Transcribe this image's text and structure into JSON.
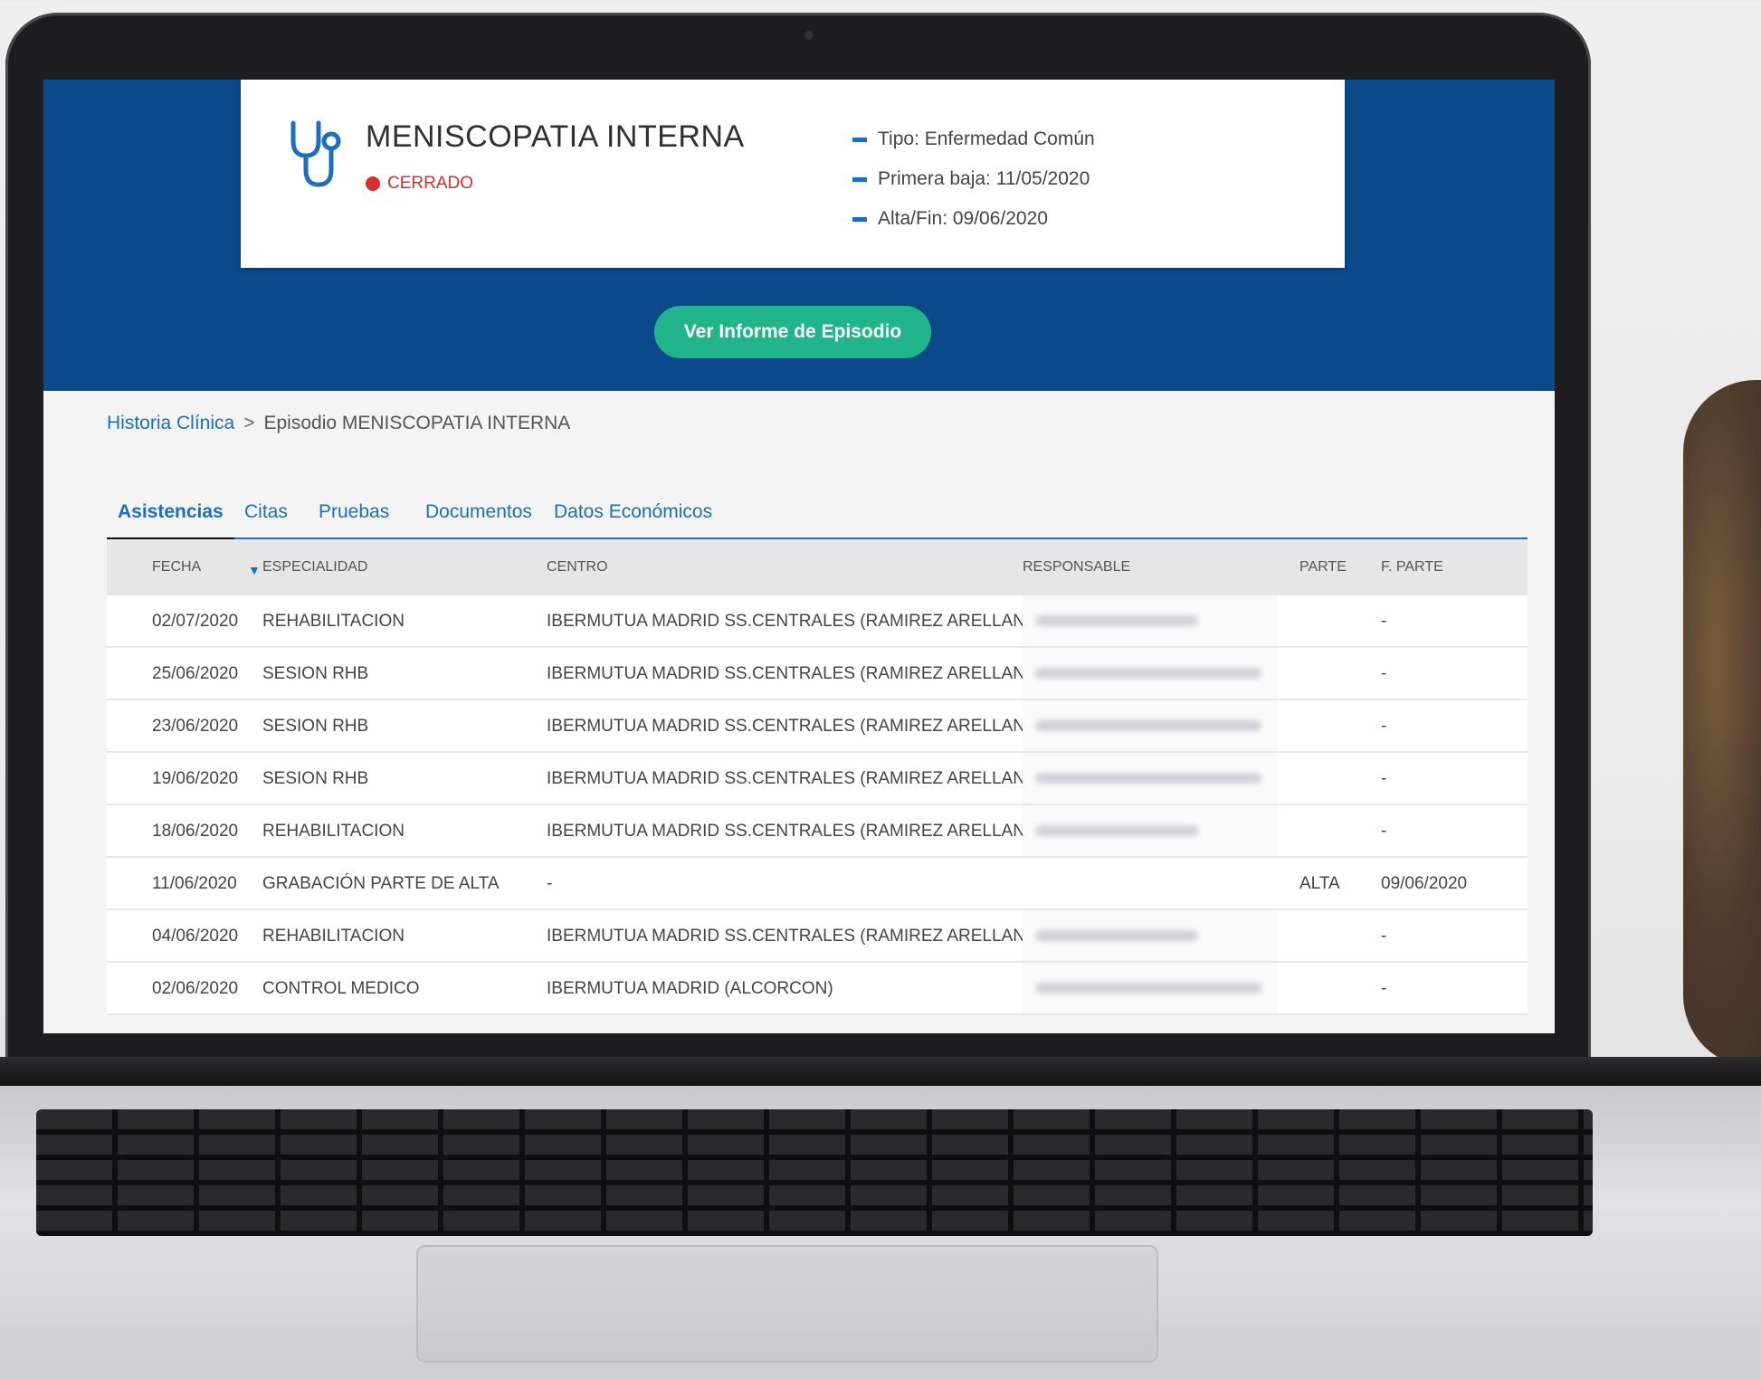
{
  "episode": {
    "title": "MENISCOPATIA INTERNA",
    "status": "CERRADO",
    "status_color": "#d32f2f",
    "info": [
      "Tipo: Enfermedad Común",
      "Primera baja: 11/05/2020",
      "Alta/Fin: 09/06/2020"
    ],
    "icon": "stethoscope-icon"
  },
  "actions": {
    "report_button": "Ver Informe de Episodio"
  },
  "breadcrumb": {
    "root": "Historia Clínica",
    "separator": ">",
    "current": "Episodio MENISCOPATIA INTERNA"
  },
  "tabs": [
    {
      "label": "Asistencias",
      "active": true
    },
    {
      "label": "Citas"
    },
    {
      "label": "Pruebas"
    },
    {
      "label": "Documentos"
    },
    {
      "label": "Datos Económicos"
    }
  ],
  "table": {
    "headers": [
      "FECHA",
      "ESPECIALIDAD",
      "CENTRO",
      "RESPONSABLE",
      "PARTE",
      "F. PARTE"
    ],
    "rows": [
      [
        "02/07/2020",
        "REHABILITACION",
        "IBERMUTUA MADRID SS.CENTRALES (RAMIREZ ARELLANO)",
        "",
        "",
        "-"
      ],
      [
        "25/06/2020",
        "SESION RHB",
        "IBERMUTUA MADRID SS.CENTRALES (RAMIREZ ARELLANO)",
        "",
        "",
        "-"
      ],
      [
        "23/06/2020",
        "SESION RHB",
        "IBERMUTUA MADRID SS.CENTRALES (RAMIREZ ARELLANO)",
        "",
        "",
        "-"
      ],
      [
        "19/06/2020",
        "SESION RHB",
        "IBERMUTUA MADRID SS.CENTRALES (RAMIREZ ARELLANO)",
        "",
        "",
        "-"
      ],
      [
        "18/06/2020",
        "REHABILITACION",
        "IBERMUTUA MADRID SS.CENTRALES (RAMIREZ ARELLANO)",
        "",
        "",
        "-"
      ],
      [
        "11/06/2020",
        "GRABACIÓN PARTE DE ALTA",
        "-",
        "",
        "ALTA",
        "09/06/2020"
      ],
      [
        "04/06/2020",
        "REHABILITACION",
        "IBERMUTUA MADRID SS.CENTRALES (RAMIREZ ARELLANO)",
        "",
        "",
        "-"
      ],
      [
        "02/06/2020",
        "CONTROL MEDICO",
        "IBERMUTUA MADRID (ALCORCON)",
        "",
        "",
        "-"
      ]
    ]
  },
  "colors": {
    "header_bg": "#0a4a8a",
    "accent": "#1a6fc0",
    "button": "#20b58a"
  }
}
